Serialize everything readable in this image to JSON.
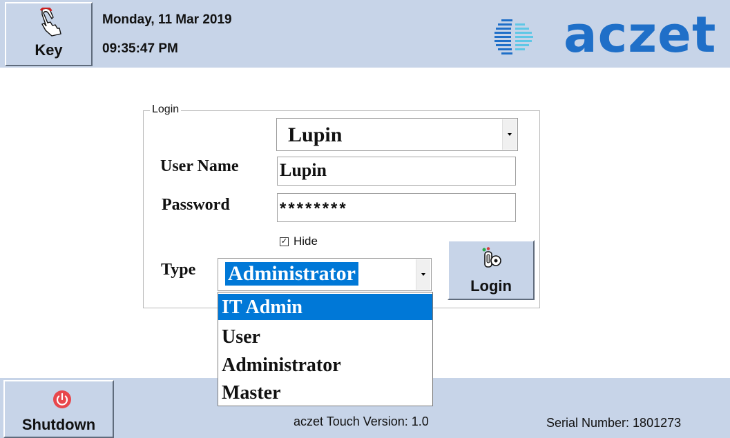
{
  "header": {
    "key_button": {
      "label": "Key",
      "icon": "pointing-hand-icon"
    },
    "date": "Monday, 11 Mar 2019",
    "time": "09:35:47 PM",
    "logo_text": "aczet"
  },
  "login": {
    "group_title": "Login",
    "user_select_value": "Lupin",
    "username_label": "User Name",
    "username_value": "Lupin",
    "password_label": "Password",
    "password_value": "********",
    "hide_label": "Hide",
    "hide_checked": true,
    "type_label": "Type",
    "type_value": "Administrator",
    "type_options": [
      "IT Admin",
      "User",
      "Administrator",
      "Master"
    ],
    "type_highlighted": "IT Admin",
    "login_button": {
      "label": "Login",
      "icon": "key-lock-icon"
    }
  },
  "footer": {
    "shutdown_button": {
      "label": "Shutdown",
      "icon": "power-icon"
    },
    "version": "aczet Touch Version: 1.0",
    "serial": "Serial Number: 1801273"
  },
  "colors": {
    "panel": "#c7d4e8",
    "selection": "#0078d7",
    "brand": "#1f6fc8",
    "power": "#e8474c"
  }
}
